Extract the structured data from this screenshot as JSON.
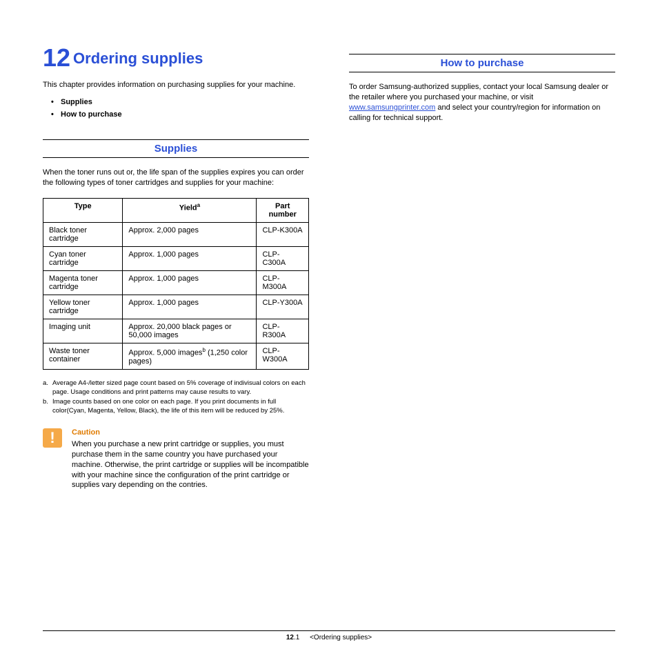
{
  "chapter": {
    "number": "12",
    "title": "Ordering supplies"
  },
  "intro": "This chapter provides information on purchasing supplies for your machine.",
  "toc": {
    "item1": "Supplies",
    "item2": "How to purchase"
  },
  "section_supplies": {
    "heading": "Supplies",
    "intro": "When the toner runs out or, the life span of the supplies expires you can order the following types of toner cartridges and supplies for your machine:"
  },
  "table": {
    "headers": {
      "type": "Type",
      "yield": "Yield",
      "yield_sup": "a",
      "part": "Part number"
    },
    "rows": [
      {
        "type": "Black toner cartridge",
        "yield": "Approx. 2,000 pages",
        "part": "CLP-K300A"
      },
      {
        "type": "Cyan toner cartridge",
        "yield": "Approx. 1,000 pages",
        "part": "CLP-C300A"
      },
      {
        "type": "Magenta toner cartridge",
        "yield": "Approx. 1,000 pages",
        "part": "CLP-M300A"
      },
      {
        "type": "Yellow toner cartridge",
        "yield": "Approx. 1,000 pages",
        "part": "CLP-Y300A"
      },
      {
        "type": "Imaging unit",
        "yield": "Approx. 20,000 black pages or 50,000 images",
        "part": "CLP-R300A"
      }
    ],
    "waste_row": {
      "type": "Waste toner container",
      "yield_pre": "Approx. 5,000 images",
      "yield_sup": "b",
      "yield_post": " (1,250 color pages)",
      "part": "CLP-W300A"
    }
  },
  "footnotes": {
    "a_marker": "a.",
    "a": "Average A4-/letter sized page count based on 5% coverage of indivisual colors on each page. Usage conditions and print patterns may cause results to vary.",
    "b_marker": "b.",
    "b": "Image counts based on one color on each page. If you print documents in full color(Cyan, Magenta, Yellow, Black), the life of this item will be reduced by 25%."
  },
  "caution": {
    "icon": "!",
    "title": "Caution",
    "body": "When you purchase a new print cartridge or supplies, you must purchase them in the same country you have purchased your machine. Otherwise, the print cartridge or supplies will be incompatible with your machine since the configuration of the print cartridge or supplies vary depending on the contries."
  },
  "section_purchase": {
    "heading": "How to purchase",
    "body_pre": "To order Samsung-authorized supplies, contact your local Samsung dealer or the retailer where you purchased your machine, or visit ",
    "link": "www.samsungprinter.com",
    "body_post": " and select your country/region for information on calling for technical support."
  },
  "footer": {
    "page_bold": "12",
    "page_rest": ".1",
    "chapter": "<Ordering supplies>"
  }
}
